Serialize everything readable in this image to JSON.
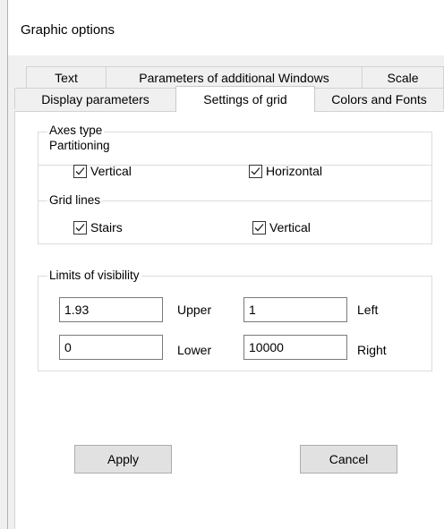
{
  "window": {
    "title": "Graphic options"
  },
  "tabs": {
    "row1": [
      "Text",
      "Parameters of additional Windows",
      "Scale"
    ],
    "row2": [
      "Display parameters",
      "Settings of grid",
      "Colors and Fonts"
    ],
    "selected": "Settings of grid"
  },
  "axes": {
    "legend": "Axes type",
    "partitioning": {
      "legend": "Partitioning",
      "vertical": {
        "label": "Vertical",
        "checked": true
      },
      "horizontal": {
        "label": "Horizontal",
        "checked": true
      }
    },
    "grid_lines": {
      "legend": "Grid lines",
      "stairs": {
        "label": "Stairs",
        "checked": true
      },
      "vertical": {
        "label": "Vertical",
        "checked": true
      }
    }
  },
  "visibility": {
    "legend": "Limits of visibility",
    "upper": {
      "value": "1.93",
      "label": "Upper"
    },
    "lower": {
      "value": "0",
      "label": "Lower"
    },
    "left": {
      "value": "1",
      "label": "Left"
    },
    "right": {
      "value": "10000",
      "label": "Right"
    }
  },
  "buttons": {
    "apply": "Apply",
    "cancel": "Cancel"
  }
}
